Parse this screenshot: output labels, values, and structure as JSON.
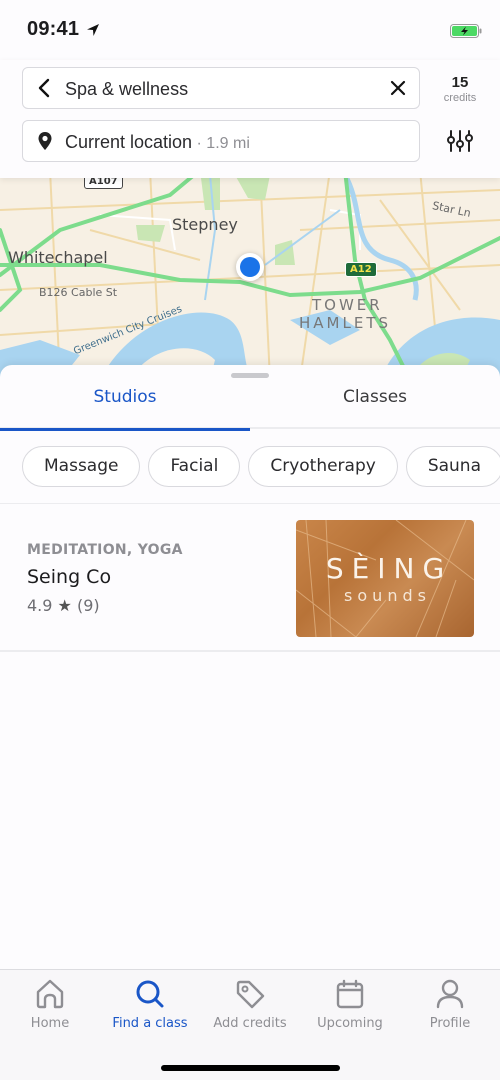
{
  "status_bar": {
    "time": "09:41",
    "location_icon": "location-arrow-icon",
    "battery_icon": "battery-charging-icon",
    "battery_color": "#4cd964"
  },
  "header": {
    "search": {
      "value": "Spa & wellness",
      "back_icon": "chevron-left-icon",
      "clear_icon": "close-icon"
    },
    "location": {
      "value": "Current location",
      "distance": " · 1.9 mi",
      "pin_icon": "map-pin-icon"
    },
    "credits": {
      "count": "15",
      "label": "credits"
    },
    "filter_icon": "sliders-icon"
  },
  "map": {
    "labels": {
      "stepney": "Stepney",
      "whitechapel": "Whitechapel",
      "cable_st": "B126  Cable St",
      "tower_hamlets_1": "TOWER",
      "tower_hamlets_2": "HAMLETS",
      "star_ln": "Star Ln",
      "cruises": "Greenwich City Cruises",
      "a107": "A107",
      "a12": "A12"
    },
    "colors": {
      "land": "#f7f0e4",
      "water": "#a9d4f0",
      "major_road": "#7ddc8c",
      "park": "#c9e6b4",
      "user_dot": "#1a73e8"
    }
  },
  "sheet": {
    "tabs": [
      {
        "label": "Studios",
        "active": true
      },
      {
        "label": "Classes",
        "active": false
      }
    ],
    "chips": [
      "Massage",
      "Facial",
      "Cryotherapy",
      "Sauna"
    ],
    "studios": [
      {
        "categories": "MEDITATION, YOGA",
        "name": "Seing Co",
        "rating": "4.9",
        "star": "★",
        "review_count": "(9)",
        "image_title": "SÈING",
        "image_subtitle": "sounds"
      }
    ]
  },
  "tabbar": {
    "accent": "#1a56c7",
    "items": [
      {
        "label": "Home",
        "icon": "home-icon",
        "active": false
      },
      {
        "label": "Find a class",
        "icon": "search-icon",
        "active": true
      },
      {
        "label": "Add credits",
        "icon": "tag-icon",
        "active": false
      },
      {
        "label": "Upcoming",
        "icon": "calendar-icon",
        "active": false
      },
      {
        "label": "Profile",
        "icon": "person-icon",
        "active": false
      }
    ]
  }
}
